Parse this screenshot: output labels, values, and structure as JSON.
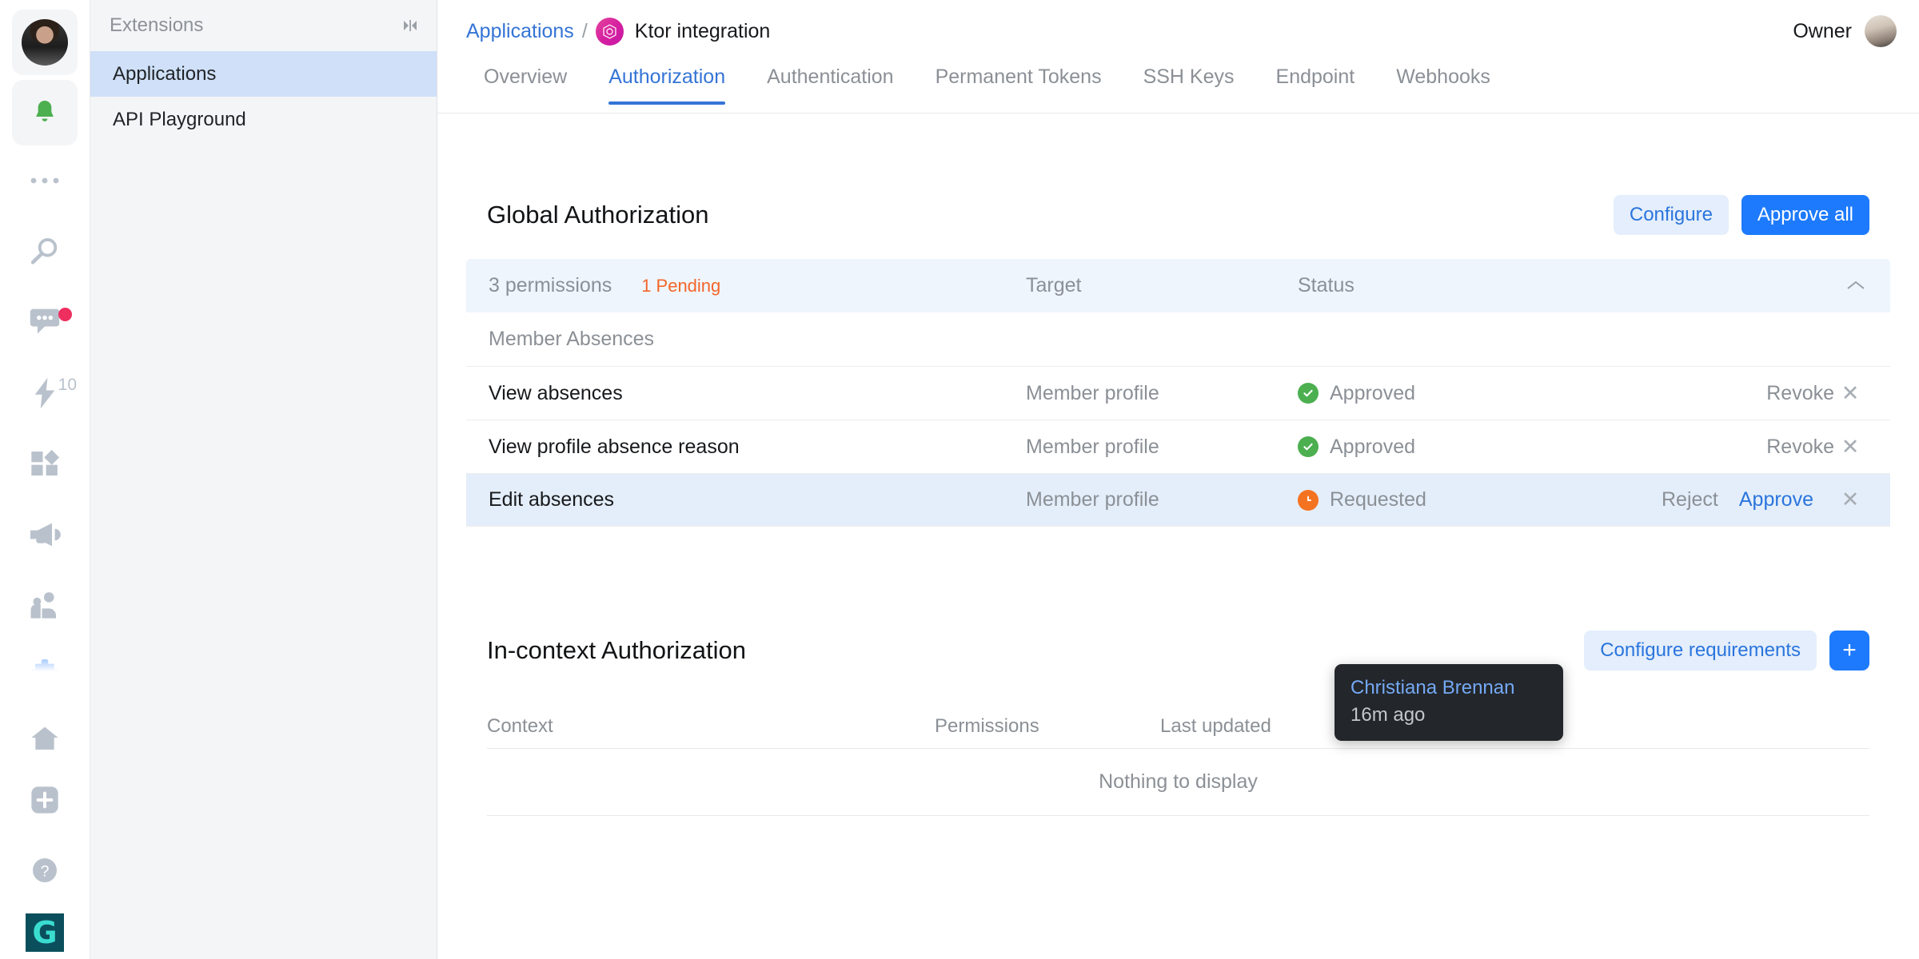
{
  "rail": {
    "items": [
      {
        "name": "user-avatar",
        "icon": "avatar"
      },
      {
        "name": "notifications",
        "icon": "bell-icon"
      },
      {
        "name": "more",
        "icon": "more-horizontal-icon"
      },
      {
        "name": "search",
        "icon": "search-icon"
      },
      {
        "name": "chats",
        "icon": "chat-icon",
        "badge": ""
      },
      {
        "name": "todo",
        "icon": "lightning-icon",
        "badge": "10"
      },
      {
        "name": "boards",
        "icon": "blocks-icon"
      },
      {
        "name": "blog",
        "icon": "megaphone-icon"
      },
      {
        "name": "meetings",
        "icon": "people-icon"
      },
      {
        "name": "extensions",
        "icon": "puzzle-icon"
      },
      {
        "name": "home",
        "icon": "home-icon"
      },
      {
        "name": "add",
        "icon": "plus-square-icon"
      },
      {
        "name": "help",
        "icon": "question-circle-icon"
      },
      {
        "name": "logo",
        "icon": "g-logo",
        "label": "G"
      }
    ],
    "badge_chat": "",
    "badge_todo": "10"
  },
  "panel": {
    "title": "Extensions",
    "collapse_icon": "collapse-panel-icon",
    "items": [
      {
        "label": "Applications",
        "active": true
      },
      {
        "label": "API Playground",
        "active": false
      }
    ]
  },
  "topbar": {
    "breadcrumb_root": "Applications",
    "breadcrumb_sep": "/",
    "breadcrumb_current": "Ktor integration",
    "app_icon": "hexagon-app-icon",
    "owner_label": "Owner",
    "avatar_name": "owner-avatar"
  },
  "tabs": [
    {
      "label": "Overview",
      "active": false
    },
    {
      "label": "Authorization",
      "active": true
    },
    {
      "label": "Authentication",
      "active": false
    },
    {
      "label": "Permanent Tokens",
      "active": false
    },
    {
      "label": "SSH Keys",
      "active": false
    },
    {
      "label": "Endpoint",
      "active": false
    },
    {
      "label": "Webhooks",
      "active": false
    }
  ],
  "global_auth": {
    "title": "Global Authorization",
    "configure_label": "Configure",
    "approve_all_label": "Approve all",
    "table": {
      "count_label": "3 permissions",
      "pending_label": "1 Pending",
      "col_target": "Target",
      "col_status": "Status",
      "collapse_chevron": "˄",
      "group_label": "Member Absences",
      "rows": [
        {
          "name": "View absences",
          "target": "Member profile",
          "status": "Approved",
          "status_kind": "approved",
          "action_primary": "",
          "action_secondary": "Revoke",
          "close": "✕",
          "selected": false
        },
        {
          "name": "View profile absence reason",
          "target": "Member profile",
          "status": "Approved",
          "status_kind": "approved",
          "action_primary": "",
          "action_secondary": "Revoke",
          "close": "✕",
          "selected": false
        },
        {
          "name": "Edit absences",
          "target": "Member profile",
          "status": "Requested",
          "status_kind": "requested",
          "action_primary": "Approve",
          "action_secondary": "Reject",
          "close": "✕",
          "selected": true
        }
      ]
    },
    "tooltip": {
      "name": "Christiana Brennan",
      "time": "16m ago"
    }
  },
  "incontext_auth": {
    "title": "In-context Authorization",
    "configure_label": "Configure requirements",
    "add_label": "+",
    "columns": {
      "context": "Context",
      "permissions": "Permissions",
      "last_updated": "Last updated"
    },
    "empty_text": "Nothing to display"
  },
  "colors": {
    "accent": "#1d7afc",
    "link": "#2a75dd",
    "pending": "#f2662a",
    "approved": "#4caf50",
    "selected_row": "#e4eefa",
    "panel_bg": "#f4f5f7"
  }
}
